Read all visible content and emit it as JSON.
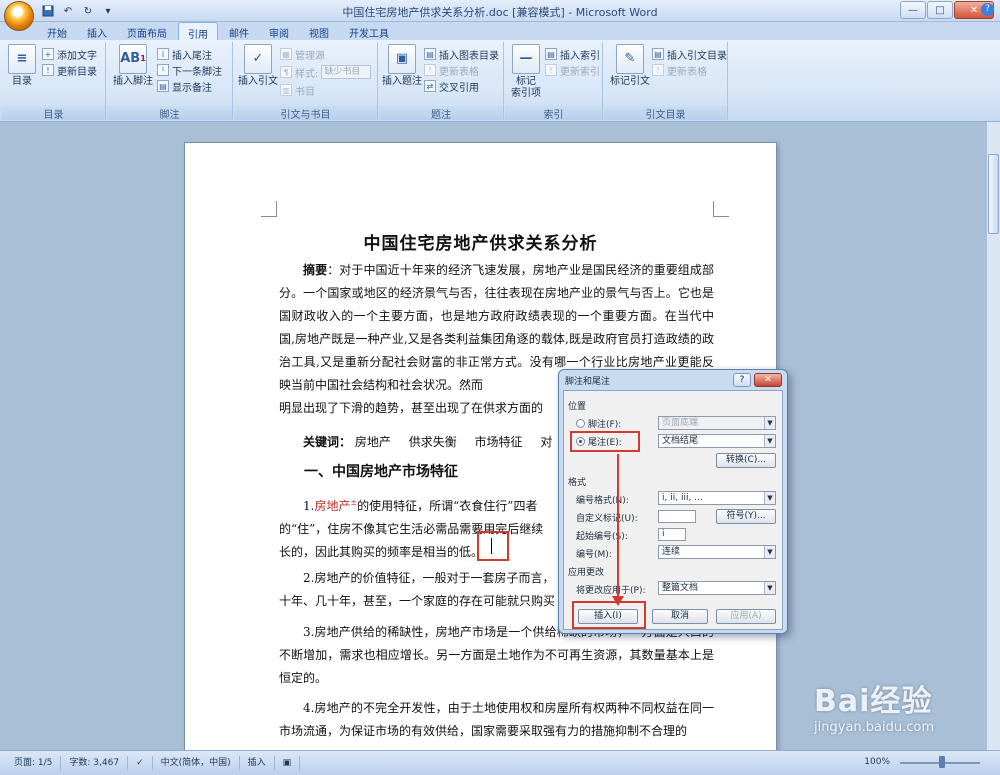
{
  "window": {
    "title": "中国住宅房地产供求关系分析.doc [兼容模式] - Microsoft Word",
    "controls": [
      "—",
      "□",
      "✕"
    ]
  },
  "qat": [
    "save-icon",
    "undo-icon",
    "redo-icon",
    "customize-icon"
  ],
  "tabs": [
    {
      "label": "开始"
    },
    {
      "label": "插入"
    },
    {
      "label": "页面布局"
    },
    {
      "label": "引用",
      "active": true
    },
    {
      "label": "邮件"
    },
    {
      "label": "审阅"
    },
    {
      "label": "视图"
    },
    {
      "label": "开发工具"
    }
  ],
  "ribbon": {
    "toc": {
      "big": "目录",
      "add_text": "添加文字",
      "update": "更新目录",
      "label": "目录"
    },
    "footnote": {
      "big": "插入脚注",
      "insert_endnote": "插入尾注",
      "next_footnote": "下一条脚注",
      "show_notes": "显示备注",
      "label": "脚注"
    },
    "citation": {
      "big": "插入引文",
      "manage": "管理源",
      "style": "样式:",
      "style_value": "缺少书目",
      "bibliography": "书目",
      "label": "引文与书目"
    },
    "caption": {
      "big": "插入题注",
      "insert_table": "插入图表目录",
      "update_table": "更新表格",
      "cross_ref": "交叉引用",
      "label": "题注"
    },
    "index": {
      "big_line1": "标记",
      "big_line2": "索引项",
      "insert": "插入索引",
      "update": "更新索引",
      "label": "索引"
    },
    "toa": {
      "big": "标记引文",
      "insert": "插入引文目录",
      "update": "更新表格",
      "label": "引文目录"
    }
  },
  "document": {
    "heading": "中国住宅房地产供求关系分析",
    "abstract_label": "摘要",
    "abstract": "：对于中国近十年来的经济飞速发展，房地产业是国民经济的重要组成部分。一个国家或地区的经济景气与否，往往表现在房地产业的景气与否上。它也是国财政收入的一个主要方面，也是地方政府政绩表现的一个重要方面。在当代中国,房地产既是一种产业,又是各类利益集团角逐的载体,既是政府官员打造政绩的政治工具,又是重新分配社会财富的非正常方式。没有哪一个行业比房地产业更能反映当前中国社会结构和社会状况。然而",
    "abstract_tail": "明显出现了下滑的趋势，甚至出现了在供求方面的",
    "keywords_label": "关键词：",
    "keywords": [
      "房地产",
      "供求失衡",
      "市场特征",
      "对"
    ],
    "section1": "一、中国房地产市场特征",
    "p1_num": "1.",
    "p1_red": "房地产",
    "p1_mark": "±",
    "p1_text": "的使用特征，所谓“衣食住行”四者",
    "p1_line2": "的“住”，住房不像其它生活必需品需要用完后继续",
    "p1_line3": "长的，因此其购买的频率是相当的低。",
    "p2": "2.房地产的价值特征，一般对于一套房子而言，",
    "p2_line2": "十年、几十年，甚至，一个家庭的存在可能就只购买",
    "p3": "3.房地产供给的稀缺性，房地产市场是一个供给稀缺的市场，一方面是人口的不断增加，需求也相应增长。另一方面是土地作为不可再生资源，其数量基本上是恒定的。",
    "p4": "4.房地产的不完全开发性，由于土地使用权和房屋所有权两种不同权益在同一市场流通，为保证市场的有效供给，国家需要采取强有力的措施抑制不合理的"
  },
  "dialog": {
    "title": "脚注和尾注",
    "help": "?",
    "close": "✕",
    "position_label": "位置",
    "footnote_label": "脚注(F):",
    "footnote_value": "页面底端",
    "endnote_label": "尾注(E):",
    "endnote_value": "文档结尾",
    "convert": "转换(C)...",
    "format_label": "格式",
    "number_format_label": "编号格式(N):",
    "number_format_value": "i, ii, iii, …",
    "custom_mark_label": "自定义标记(U):",
    "custom_mark_value": "",
    "symbol": "符号(Y)...",
    "start_at_label": "起始编号(S):",
    "start_at_value": "i",
    "numbering_label": "编号(M):",
    "numbering_value": "连续",
    "apply_label": "应用更改",
    "apply_to_label": "将更改应用于(P):",
    "apply_to_value": "整篇文档",
    "insert": "插入(I)",
    "cancel": "取消",
    "apply": "应用(A)"
  },
  "status": {
    "page": "页面: 1/5",
    "words": "字数: 3,467",
    "lang": "中文(简体，中国)",
    "mode": "插入",
    "zoom": "100%"
  },
  "watermark": {
    "brand": "Bai经验",
    "url": "jingyan.baidu.com"
  }
}
